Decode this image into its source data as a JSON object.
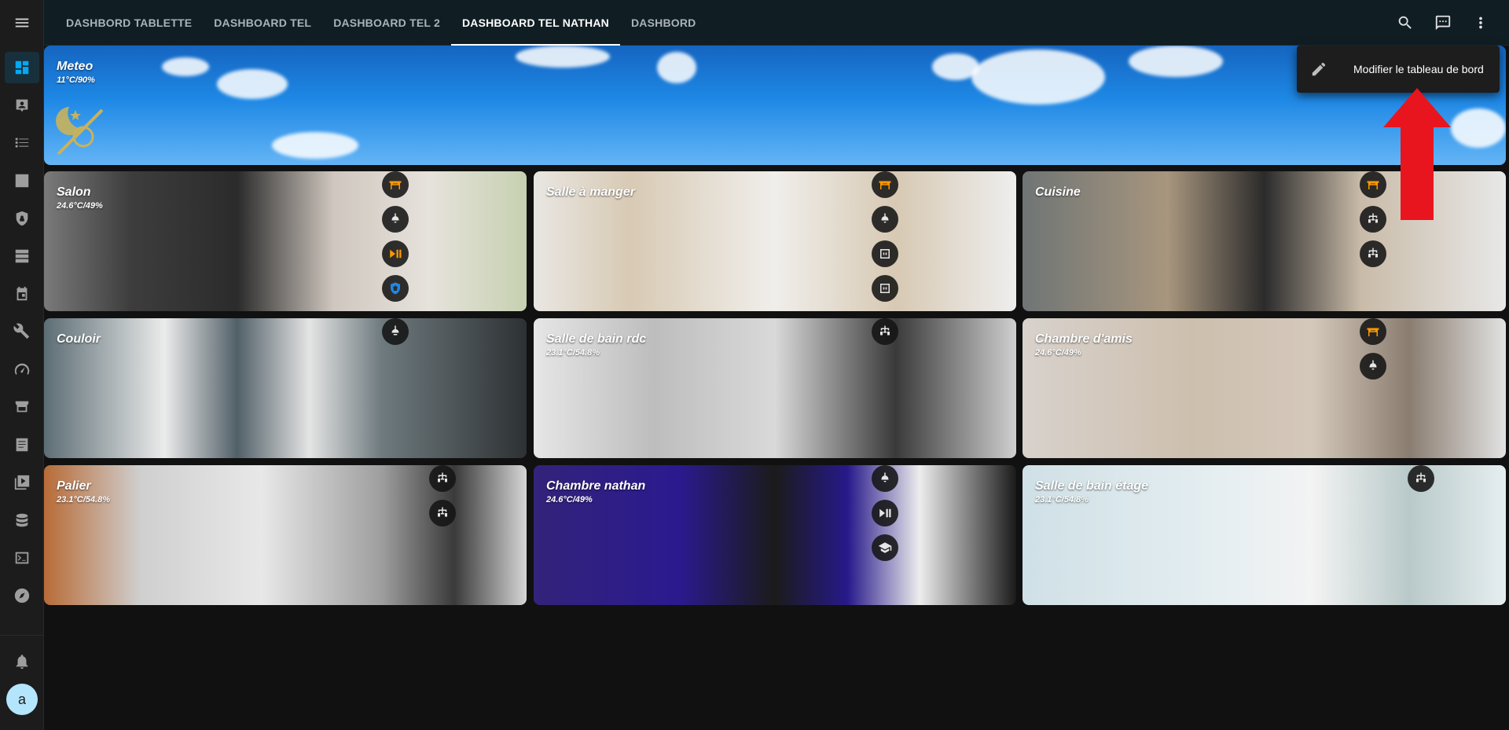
{
  "header": {
    "tabs": [
      {
        "label": "DASHBORD TABLETTE",
        "active": false
      },
      {
        "label": "DASHBOARD TEL",
        "active": false
      },
      {
        "label": "DASHBOARD TEL 2",
        "active": false
      },
      {
        "label": "DASHBOARD TEL NATHAN",
        "active": true
      },
      {
        "label": "DASHBORD",
        "active": false
      }
    ],
    "actions": [
      "search-icon",
      "assist-icon",
      "more-vert-icon"
    ]
  },
  "sidebar": {
    "items": [
      "dashboard-icon",
      "map-icon",
      "logbook-icon",
      "history-icon",
      "security-icon",
      "hacs-icon",
      "calendar-icon",
      "developer-tools-icon",
      "energy-icon",
      "store-icon",
      "log-icon",
      "media-icon",
      "database-icon",
      "terminal-icon",
      "compass-icon"
    ],
    "notifications_icon": "bell-icon",
    "user_initial": "a"
  },
  "menu": {
    "edit_label": "Modifier le tableau de bord",
    "edit_icon": "pencil-icon"
  },
  "cards": {
    "meteo": {
      "title": "Meteo",
      "subtitle": "11°C/90%"
    },
    "salon": {
      "title": "Salon",
      "subtitle": "24.6°C/49%"
    },
    "salle_manger": {
      "title": "Salle à manger",
      "subtitle": ""
    },
    "cuisine": {
      "title": "Cuisine",
      "subtitle": ""
    },
    "couloir": {
      "title": "Couloir",
      "subtitle": ""
    },
    "sdb_rdc": {
      "title": "Salle de bain rdc",
      "subtitle": "23.1°C/54.8%"
    },
    "chambre_amis": {
      "title": "Chambre d'amis",
      "subtitle": "24.6°C/49%"
    },
    "palier": {
      "title": "Palier",
      "subtitle": "23.1°C/54.8%"
    },
    "chambre_nathan": {
      "title": "Chambre nathan",
      "subtitle": "24.6°C/49%"
    },
    "sdb_etage": {
      "title": "Salle de bain étage",
      "subtitle": "23.1°C/54.8%"
    }
  },
  "colors": {
    "accent": "#03a9f4",
    "active_icon": "#ff9800",
    "annotation_arrow": "#e8151f",
    "header_bg": "#101e24"
  }
}
